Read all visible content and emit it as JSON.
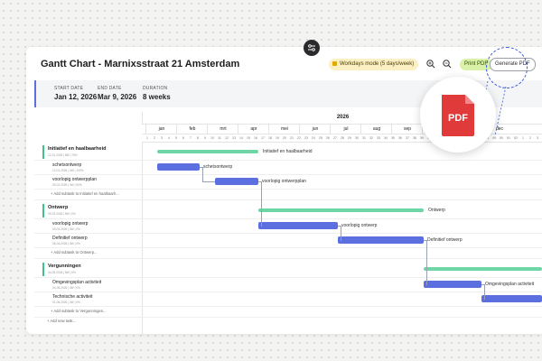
{
  "title": "Gantt Chart - Marnixsstraat 21 Amsterdam",
  "toolbar": {
    "workdays_label": "Workdays mode (5 days/week)",
    "print_label": "Print PDF",
    "generate_label": "Generate PDF",
    "zoom_in_icon": "zoom-in-icon",
    "zoom_out_icon": "zoom-out-icon"
  },
  "info": {
    "start_label": "START DATE",
    "start_value": "Jan 12, 2026",
    "end_label": "END DATE",
    "end_value": "Mar 9, 2026",
    "duration_label": "DURATION",
    "duration_value": "8 weeks"
  },
  "timeline": {
    "year": "2026",
    "months": [
      "jan",
      "feb",
      "mrt",
      "apr",
      "mei",
      "jun",
      "jul",
      "aug",
      "sep",
      "okt",
      "nov",
      "dec"
    ]
  },
  "phases": [
    {
      "name": "Initiatief en haalbaarheid",
      "dates": "12-01-2026 | 8W | 75%",
      "bar_label": "Initiatief en haalbaarheid",
      "add_label": "+ Add subtask to Initiatief en haalbaarh...",
      "tasks": [
        {
          "name": "schetsontwerp",
          "dates": "12-01-2026 | 4W | 100%",
          "bar_label": "schetsontwerp"
        },
        {
          "name": "voorlopig ontwerpplan",
          "dates": "09-02-2026 | 4W | 50%",
          "bar_label": "voorlopig ontwerpplan"
        }
      ]
    },
    {
      "name": "Ontwerp",
      "dates": "09-03-2026 | 8W | 0%",
      "bar_label": "Ontwerp",
      "add_label": "+ Add subtask to Ontwerp...",
      "tasks": [
        {
          "name": "voorlopig ontwerp",
          "dates": "09-03-2026 | 4W | 0%",
          "bar_label": "voorlopig ontwerp"
        },
        {
          "name": "Definitief ontwerp",
          "dates": "06-04-2026 | 4W | 0%",
          "bar_label": "Definitief ontwerp"
        }
      ]
    },
    {
      "name": "Vergunningen",
      "dates": "04-05-2026 | 8W | 0%",
      "bar_label": "",
      "add_label": "+ Add subtask to Vergunningen...",
      "tasks": [
        {
          "name": "Omgevingsplan activiteit",
          "dates": "04-05-2026 | 4W | 0%",
          "bar_label": "Omgevingsplan activiteit"
        },
        {
          "name": "Technische activiteit",
          "dates": "01-06-2026 | 4W | 0%",
          "bar_label": ""
        }
      ]
    }
  ],
  "add_task_label": "+ Add new task...",
  "callout": {
    "pdf_text": "PDF"
  },
  "colors": {
    "phase_bar": "#6dd6a4",
    "task_bar": "#5b6fe0",
    "accent": "#3ec48a"
  }
}
